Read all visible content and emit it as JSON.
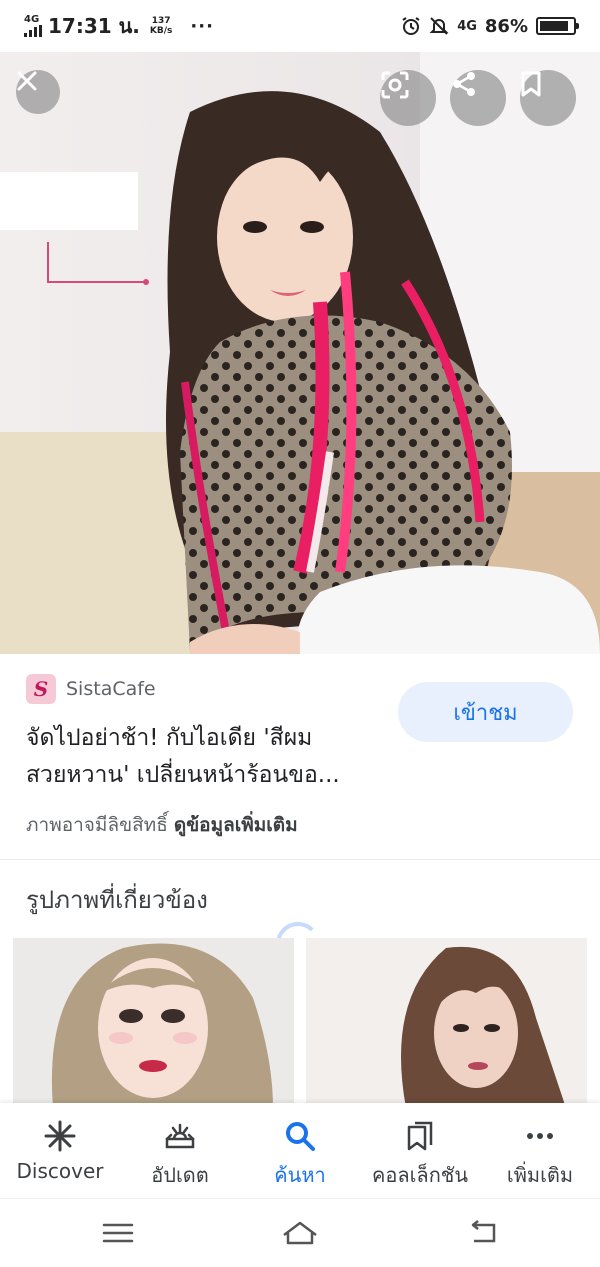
{
  "status_bar": {
    "network_top": "4G",
    "time": "17:31 น.",
    "speed_value": "137",
    "speed_unit": "KB/s",
    "more": "···",
    "network_right": "4G",
    "battery_percent": "86%",
    "battery_level": 0.86,
    "icons": [
      "signal-icon",
      "alarm-icon",
      "notifications-off-icon",
      "battery-icon"
    ]
  },
  "viewer": {
    "close_icon": "close-icon",
    "lens_icon": "lens-icon",
    "share_icon": "share-icon",
    "save_icon": "bookmark-icon"
  },
  "result": {
    "source_initial": "S",
    "source_name": "SistaCafe",
    "title_line1": "จัดไปอย่าช้า! กับไอเดีย 'สีผม",
    "title_line2": "สวยหวาน' เปลี่ยนหน้าร้อนขอ...",
    "visit_label": "เข้าชม",
    "copyright_text": "ภาพอาจมีลิขสิทธิ์",
    "more_info_label": "ดูข้อมูลเพิ่มเติม"
  },
  "related": {
    "heading": "รูปภาพที่เกี่ยวข้อง"
  },
  "bottom_nav": {
    "items": [
      {
        "label": "Discover",
        "icon": "discover-icon"
      },
      {
        "label": "อัปเดต",
        "icon": "updates-icon"
      },
      {
        "label": "ค้นหา",
        "icon": "search-icon"
      },
      {
        "label": "คอลเล็กชัน",
        "icon": "collections-icon"
      },
      {
        "label": "เพิ่มเติม",
        "icon": "more-icon"
      }
    ],
    "active_index": 2
  },
  "colors": {
    "accent": "#1a73e8",
    "accent_bg": "#e8f0fe",
    "hair_pink": "#e91e63"
  }
}
